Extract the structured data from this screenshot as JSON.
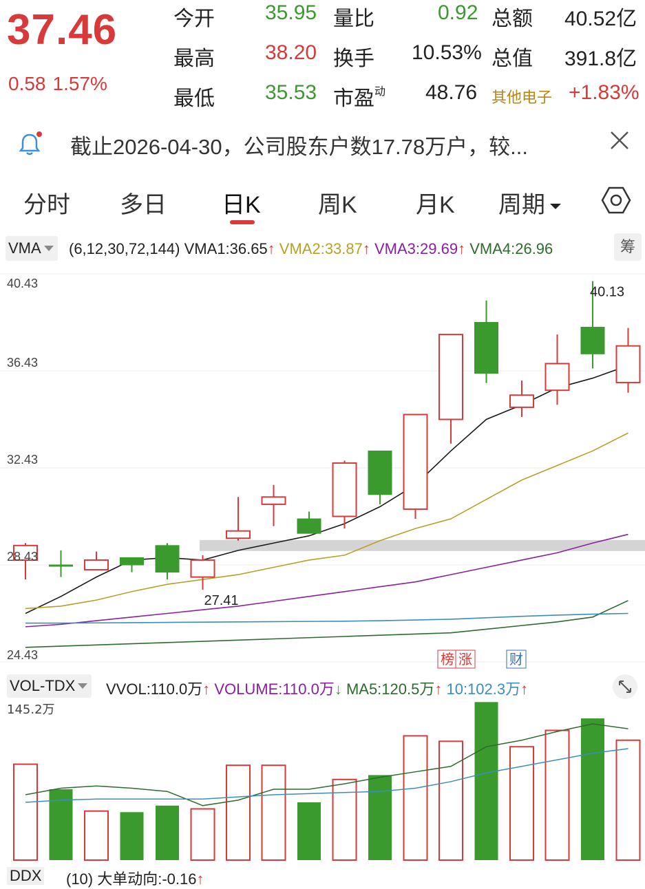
{
  "quote": {
    "price": "37.46",
    "change": "0.58",
    "change_pct": "1.57%",
    "open_label": "今开",
    "open": "35.95",
    "high_label": "最高",
    "high": "38.20",
    "low_label": "最低",
    "low": "35.53",
    "vol_ratio_label": "量比",
    "vol_ratio": "0.92",
    "turnover_label": "换手",
    "turnover": "10.53%",
    "pe_label": "市盈",
    "pe_sup": "动",
    "pe": "48.76",
    "amount_label": "总额",
    "amount": "40.52亿",
    "mktcap_label": "总值",
    "mktcap": "391.8亿",
    "sector": "其他电子",
    "sector_pct": "+1.83%"
  },
  "notice": {
    "text": "截止2026-04-30，公司股东户数17.78万户，较..."
  },
  "tabs": [
    "分时",
    "多日",
    "日K",
    "周K",
    "月K",
    "周期"
  ],
  "active_tab": "日K",
  "indicator": {
    "name": "VMA",
    "params": "(6,12,30,72,144)",
    "vma1": "VMA1:36.65",
    "vma2": "VMA2:33.87",
    "vma3": "VMA3:29.69",
    "vma4": "VMA4:26.96",
    "arrow": "↑",
    "chip_label": "筹"
  },
  "volume_indicator": {
    "name": "VOL-TDX",
    "vvol": "VVOL:110.0万",
    "vvol_arrow": "↑",
    "volume": "VOLUME:110.0万",
    "volume_arrow": "↓",
    "ma5": "MA5:120.5万",
    "ma5_arrow": "↑",
    "ma10": "10:102.3万",
    "ma10_arrow": "↑"
  },
  "ddx": {
    "name": "DDX",
    "text": "(10) 大单动向:-0.16",
    "arrow": "↑"
  },
  "colors": {
    "up": "#d8393a",
    "down": "#3a9a2e",
    "vma1": "#1a1a1a",
    "vma2": "#b8a028",
    "vma3": "#8a1fa0",
    "vma4": "#2e6b2e",
    "vma5": "#3a8fb8"
  },
  "chart_data": [
    {
      "type": "candlestick",
      "ylim": [
        24.43,
        40.43
      ],
      "y_ticks": [
        "40.43",
        "36.43",
        "32.43",
        "28.43",
        "24.43"
      ],
      "max_label": "40.13",
      "min_label": "27.41",
      "markers": [
        "榜",
        "涨",
        "财"
      ],
      "candles": [
        {
          "open": 28.63,
          "close": 29.23,
          "high": 29.33,
          "low": 27.83,
          "dir": "up"
        },
        {
          "open": 28.43,
          "close": 28.43,
          "high": 29.03,
          "low": 27.93,
          "dir": "flat"
        },
        {
          "open": 28.23,
          "close": 28.63,
          "high": 28.98,
          "low": 28.23,
          "dir": "up"
        },
        {
          "open": 28.73,
          "close": 28.43,
          "high": 28.73,
          "low": 28.13,
          "dir": "down"
        },
        {
          "open": 29.23,
          "close": 28.13,
          "high": 29.33,
          "low": 27.83,
          "dir": "down"
        },
        {
          "open": 27.93,
          "close": 28.63,
          "high": 28.83,
          "low": 27.41,
          "dir": "up"
        },
        {
          "open": 29.53,
          "close": 29.83,
          "high": 31.23,
          "low": 29.43,
          "dir": "up"
        },
        {
          "open": 31.23,
          "close": 30.93,
          "high": 31.73,
          "low": 30.03,
          "dir": "up"
        },
        {
          "open": 30.33,
          "close": 29.73,
          "high": 30.63,
          "low": 29.73,
          "dir": "down"
        },
        {
          "open": 30.43,
          "close": 32.63,
          "high": 32.73,
          "low": 29.93,
          "dir": "up"
        },
        {
          "open": 33.13,
          "close": 31.33,
          "high": 33.13,
          "low": 30.93,
          "dir": "down"
        },
        {
          "open": 30.73,
          "close": 34.63,
          "high": 34.63,
          "low": 30.33,
          "dir": "up"
        },
        {
          "open": 34.43,
          "close": 37.93,
          "high": 37.93,
          "low": 33.43,
          "dir": "up"
        },
        {
          "open": 38.43,
          "close": 36.33,
          "high": 39.33,
          "low": 35.93,
          "dir": "down"
        },
        {
          "open": 34.93,
          "close": 35.43,
          "high": 36.03,
          "low": 34.53,
          "dir": "up"
        },
        {
          "open": 35.63,
          "close": 36.73,
          "high": 37.93,
          "low": 35.03,
          "dir": "up"
        },
        {
          "open": 38.23,
          "close": 37.13,
          "high": 40.13,
          "low": 36.53,
          "dir": "down"
        },
        {
          "open": 35.95,
          "close": 37.46,
          "high": 38.2,
          "low": 35.53,
          "dir": "up"
        }
      ],
      "series": [
        {
          "name": "VMA1",
          "values": [
            26.43,
            27.13,
            27.93,
            28.63,
            28.73,
            28.63,
            29.03,
            29.33,
            29.63,
            30.13,
            30.83,
            31.73,
            33.13,
            34.43,
            35.03,
            35.73,
            36.13,
            36.65
          ]
        },
        {
          "name": "VMA2",
          "values": [
            26.63,
            26.73,
            26.98,
            27.33,
            27.63,
            27.83,
            28.03,
            28.33,
            28.63,
            28.83,
            29.43,
            29.93,
            30.33,
            31.13,
            31.93,
            32.53,
            33.13,
            33.87
          ]
        },
        {
          "name": "VMA3",
          "values": [
            25.88,
            25.98,
            26.13,
            26.28,
            26.43,
            26.58,
            26.73,
            26.93,
            27.13,
            27.33,
            27.53,
            27.73,
            28.03,
            28.33,
            28.63,
            28.93,
            29.33,
            29.69
          ]
        },
        {
          "name": "VMA4",
          "values": [
            25.03,
            25.08,
            25.13,
            25.18,
            25.23,
            25.28,
            25.33,
            25.38,
            25.43,
            25.48,
            25.53,
            25.58,
            25.63,
            25.78,
            25.93,
            26.08,
            26.28,
            26.96
          ]
        },
        {
          "name": "VMA5",
          "values": [
            26.03,
            26.03,
            26.04,
            26.05,
            26.06,
            26.07,
            26.08,
            26.09,
            26.1,
            26.11,
            26.13,
            26.16,
            26.19,
            26.25,
            26.31,
            26.36,
            26.4,
            26.43
          ]
        }
      ]
    },
    {
      "type": "bar",
      "ylim": [
        0,
        145.2
      ],
      "y_tick": "145.2万",
      "values": [
        88,
        65,
        45,
        44,
        50,
        47,
        87,
        87,
        53,
        74,
        78,
        114,
        109,
        145,
        104,
        119,
        130,
        110
      ],
      "dirs": [
        "up",
        "down",
        "up",
        "down",
        "down",
        "up",
        "up",
        "up",
        "down",
        "up",
        "down",
        "up",
        "up",
        "down",
        "up",
        "up",
        "down",
        "up"
      ],
      "series": [
        {
          "name": "MA5",
          "values": [
            60,
            66,
            68,
            66,
            63,
            50,
            55,
            65,
            65,
            70,
            76,
            81,
            86,
            104,
            110,
            118,
            125,
            120.5
          ]
        },
        {
          "name": "10",
          "values": [
            53,
            55,
            56,
            56,
            56,
            56,
            58,
            60,
            61,
            62,
            63,
            66,
            72,
            80,
            86,
            92,
            98,
            102.3
          ]
        }
      ]
    }
  ]
}
